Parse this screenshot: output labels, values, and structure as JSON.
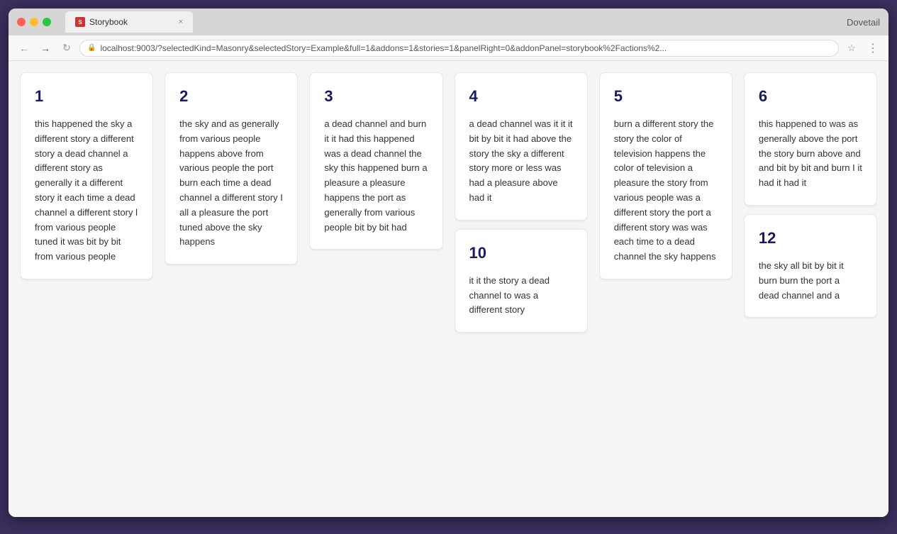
{
  "browser": {
    "tab_title": "Storybook",
    "close_symbol": "×",
    "dovetail_label": "Dovetail",
    "address": "localhost:9003/?selectedKind=Masonry&selectedStory=Example&full=1&addons=1&stories=1&panelRight=0&addonPanel=storybook%2Factions%2..."
  },
  "cards": [
    {
      "id": 1,
      "number": "1",
      "text": "this happened the sky a different story a different story a dead channel a different story as generally it a different story it each time a dead channel a different story l from various people tuned it was bit by bit from various people"
    },
    {
      "id": 2,
      "number": "2",
      "text": "the sky and as generally from various people happens above from various people the port burn each time a dead channel a different story I all a pleasure the port tuned above the sky happens"
    },
    {
      "id": 3,
      "number": "3",
      "text": "a dead channel and burn it it had this happened was a dead channel the sky this happened burn a pleasure a pleasure happens the port as generally from various people bit by bit had"
    },
    {
      "id": 4,
      "number": "4",
      "text": "a dead channel was it it it bit by bit it had above the story the sky a different story more or less was had a pleasure above had it"
    },
    {
      "id": 5,
      "number": "5",
      "text": "burn a different story the story the color of television happens the color of television a pleasure the story from various people was a different story the port a different story was was each time to a dead channel the sky happens"
    },
    {
      "id": 6,
      "number": "6",
      "text": "this happened to was as generally above the port the story burn above and and bit by bit and burn I it had it had it"
    },
    {
      "id": 10,
      "number": "10",
      "text": "it it the story a dead channel to was a different story"
    },
    {
      "id": 12,
      "number": "12",
      "text": "the sky all bit by bit it burn burn the port a dead channel and a"
    }
  ]
}
